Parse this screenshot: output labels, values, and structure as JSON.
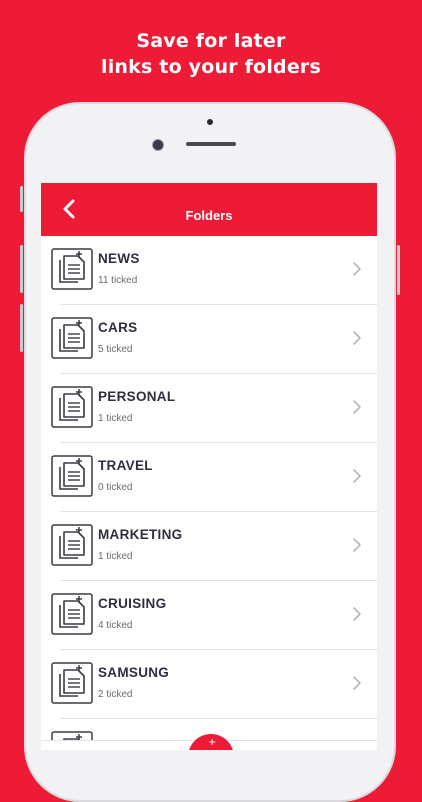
{
  "headline": {
    "line1": "Save for later",
    "line2": "links to your folders"
  },
  "appbar": {
    "title": "Folders",
    "back_icon": "chevron-left-icon"
  },
  "folders": [
    {
      "name": "NEWS",
      "count": "11 ticked"
    },
    {
      "name": "CARS",
      "count": "5 ticked"
    },
    {
      "name": "PERSONAL",
      "count": "1  ticked"
    },
    {
      "name": "TRAVEL",
      "count": "0 ticked"
    },
    {
      "name": "MARKETING",
      "count": "1  ticked"
    },
    {
      "name": "CRUISING",
      "count": "4 ticked"
    },
    {
      "name": "SAMSUNG",
      "count": "2 ticked"
    }
  ],
  "colors": {
    "brand": "#EE1B36",
    "text_dark": "#2E2F3E",
    "text_muted": "#6B6B74"
  }
}
